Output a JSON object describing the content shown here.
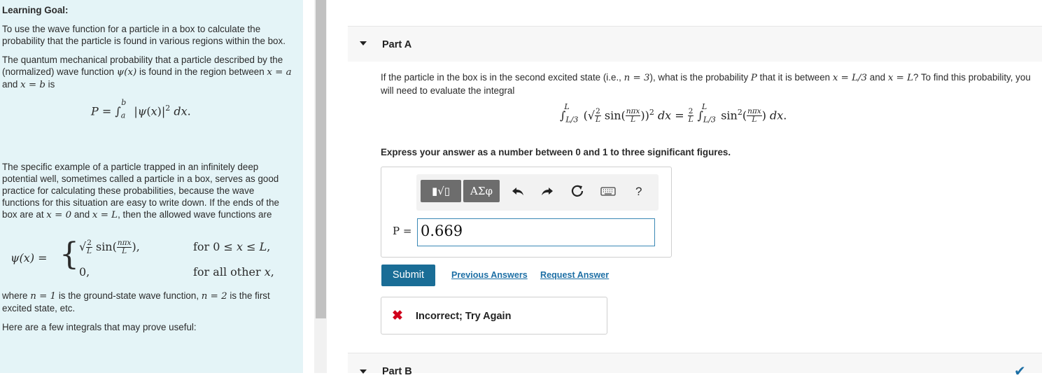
{
  "left_panel": {
    "goal_title": "Learning Goal:",
    "goal_text": "To use the wave function for a particle in a box to calculate the probability that the particle is found in various regions within the box.",
    "para1_a": "The quantum mechanical probability that a particle described by the (normalized) wave function ",
    "para1_psi": "ψ(x)",
    "para1_b": " is found in the region between ",
    "para1_xa": "x = a",
    "para1_and": " and ",
    "para1_xb": "x = b",
    "para1_c": " is",
    "eq_P": "P = ∫ₐᵇ |ψ(x)|² dx.",
    "para2_a": "The specific example of a particle trapped in an infinitely deep potential well, sometimes called a particle in a box, serves as good practice for calculating these probabilities, because the wave functions for this situation are easy to write down. If the ends of the box are at ",
    "para2_x0": "x = 0",
    "para2_and": " and ",
    "para2_xL": "x = L",
    "para2_b": ", then the allowed wave functions are",
    "psi_lhs": "ψ(x) =",
    "psi_case1": "√(2/L) sin(nπx/L),",
    "psi_cond1": "for 0 ≤ x ≤ L,",
    "psi_case2": "0,",
    "psi_cond2": "for all other x,",
    "para3_a": "where ",
    "para3_n1": "n = 1",
    "para3_b": " is the ground-state wave function, ",
    "para3_n2": "n = 2",
    "para3_c": " is the first excited state, etc.",
    "para4": "Here are a few integrals that may prove useful:"
  },
  "part_a": {
    "title": "Part A",
    "question_a": "If the particle in the box is in the second excited state (i.e., ",
    "question_n": "n = 3",
    "question_b": "), what is the probability ",
    "question_P": "P",
    "question_c": " that it is between ",
    "question_x1": "x = L/3",
    "question_d": " and ",
    "question_x2": "x = L",
    "question_e": "? To find this probability, you will need to evaluate the integral",
    "integral": "∫L/3L (√(2/L) sin(nπx/L))² dx = 2/L ∫L/3L sin²(nπx/L) dx.",
    "instruction": "Express your answer as a number between 0 and 1 to three significant figures.",
    "toolbar": {
      "templates_label": "▮√▯",
      "greek_label": "ΑΣφ",
      "help_label": "?"
    },
    "answer_label": "P =",
    "answer_value": "0.669",
    "submit_label": "Submit",
    "previous_answers_label": "Previous Answers",
    "request_answer_label": "Request Answer",
    "feedback_icon": "✖",
    "feedback_text": "Incorrect; Try Again"
  },
  "part_b": {
    "title": "Part B",
    "status_icon": "✔"
  },
  "colors": {
    "left_bg": "#e4f4f7",
    "accent": "#1a6d96",
    "link": "#1d6fa5",
    "error": "#d0021b"
  }
}
